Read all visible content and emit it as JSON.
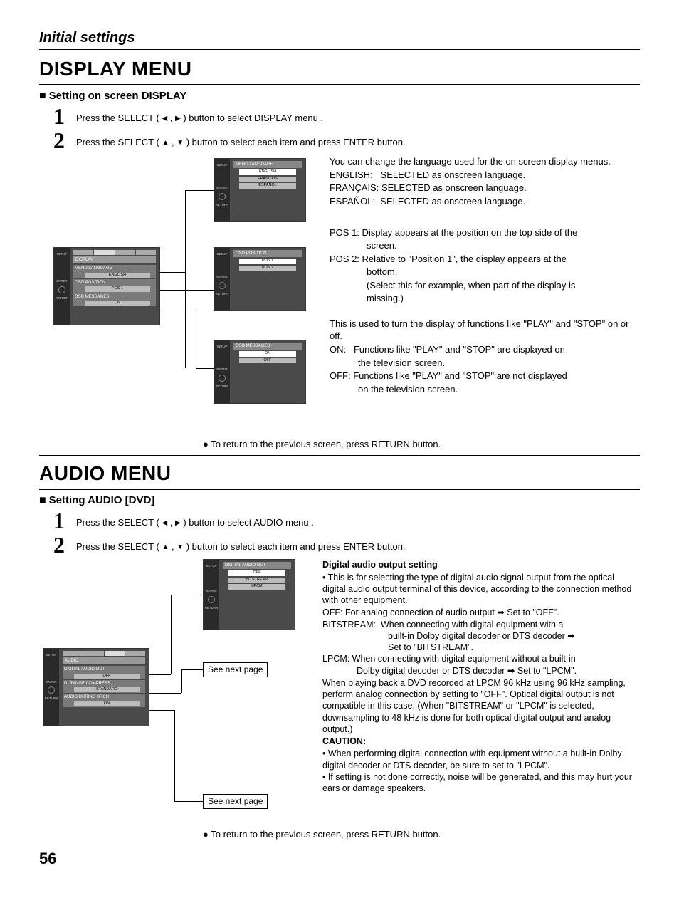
{
  "chapter": "Initial settings",
  "pageNumber": "56",
  "displayMenu": {
    "title": "DISPLAY MENU",
    "subTitle": "Setting on screen DISPLAY",
    "step1a": "Press the SELECT (",
    "step1b": ") button to select DISPLAY menu .",
    "step2a": "Press the SELECT (",
    "step2b": ") button to select each item and press ENTER button.",
    "langIntro": "You can change the language used for the on screen display menus.",
    "langEn": "ENGLISH:   SELECTED as onscreen language.",
    "langFr": "FRANÇAIS: SELECTED as onscreen language.",
    "langEs": "ESPAÑOL:  SELECTED as onscreen language.",
    "pos1a": "POS 1: Display appears at the position on the top side of the",
    "pos1b": "screen.",
    "pos2a": "POS 2: Relative to \"Position 1\", the display appears at the",
    "pos2b": "bottom.",
    "pos2c": "(Select this for example, when part of the display is",
    "pos2d": "missing.)",
    "msgIntro": "This is used to turn the display of functions like \"PLAY\" and \"STOP\" on or off.",
    "msgOn1": "ON:   Functions like \"PLAY\" and \"STOP\" are displayed on",
    "msgOn2": "the television screen.",
    "msgOff1": "OFF: Functions like \"PLAY\" and \"STOP\" are not displayed",
    "msgOff2": "on the television screen.",
    "returnNote": "To return to the previous screen, press RETURN button.",
    "osdMain": {
      "setup": "SETUP",
      "enter": "ENTER",
      "return": "RETURN",
      "tab": "DISPLAY",
      "r1": "MENU LANGUAGE",
      "r1v": "ENGLISH",
      "r2": "OSD POSITION",
      "r2v": "POS  1",
      "r3": "OSD MESSAGES",
      "r3v": "ON"
    },
    "osdLang": {
      "title": "MENU LANGUAGE",
      "o1": "ENGLISH",
      "o2": "FRANÇAIS",
      "o3": "ESPAÑOL"
    },
    "osdPos": {
      "title": "OSD POSITION",
      "o1": "POS 1",
      "o2": "POS 2"
    },
    "osdMsg": {
      "title": "OSD MESSAGES",
      "o1": "ON",
      "o2": "OFF"
    }
  },
  "audioMenu": {
    "title": "AUDIO MENU",
    "subTitle": "Setting AUDIO [DVD]",
    "step1a": "Press the SELECT (",
    "step1b": ") button to select AUDIO menu .",
    "step2a": "Press the SELECT (",
    "step2b": ") button to select each item and press ENTER button.",
    "seeNext": "See next page",
    "heading": "Digital audio output setting",
    "b1": "This is for selecting the type of digital audio signal output from the optical digital audio output terminal of this device, according to the connection method with other equipment.",
    "off": "OFF: For analog connection of audio output ➡ Set to \"OFF\".",
    "bit1": "BITSTREAM:  When connecting with digital equipment with a",
    "bit2": "built-in Dolby digital decoder or DTS decoder ➡",
    "bit3": "Set to \"BITSTREAM\".",
    "lp1": "LPCM: When connecting with digital equipment without a built-in",
    "lp2": "Dolby digital decoder or DTS decoder ➡ Set to \"LPCM\".",
    "note": "When playing back a DVD recorded at LPCM 96 kHz using 96 kHz sampling, perform analog connection by setting to \"OFF\". Optical digital output is not compatible in this case. (When \"BITSTREAM\" or \"LPCM\" is selected, downsampling to 48 kHz is done for both optical digital output and analog output.)",
    "caution": "CAUTION:",
    "c1": "When performing digital connection with equipment without a built-in Dolby digital decoder or DTS decoder, be sure to set to \"LPCM\".",
    "c2": "If setting is not done correctly, noise will be generated, and this may hurt your ears or damage speakers.",
    "returnNote": "To return to the previous screen, press RETURN button.",
    "osdMain": {
      "setup": "SETUP",
      "enter": "ENTER",
      "return": "RETURN",
      "tab": "AUDIO",
      "r1": "DIGITAL AUDIO OUT",
      "r1v": "OFF",
      "r2": "D. RANGE COMPRESS.",
      "r2v": "STANDARD",
      "r3": "AUDIO DURING SRCH",
      "r3v": "ON"
    },
    "osdDig": {
      "title": "DIGITAL AUDIO OUT",
      "o1": "OFF",
      "o2": "BITSTREAM",
      "o3": "LPCM"
    }
  }
}
